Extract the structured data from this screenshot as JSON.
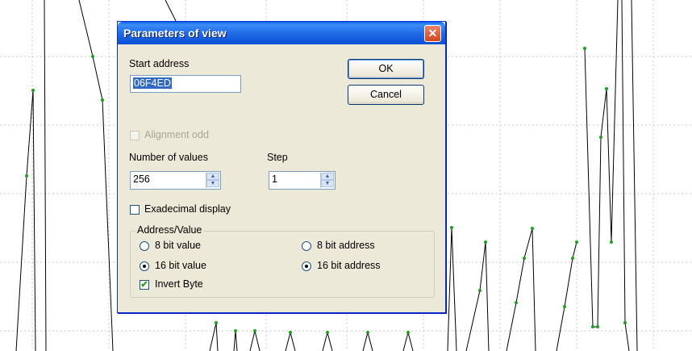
{
  "dialog": {
    "title": "Parameters of view",
    "start_address_label": "Start address",
    "start_address_value": "06F4ED",
    "ok_label": "OK",
    "cancel_label": "Cancel",
    "alignment_label": "Alignment odd",
    "alignment_checked": false,
    "alignment_enabled": false,
    "num_values_label": "Number of values",
    "num_values_value": "256",
    "step_label": "Step",
    "step_value": "1",
    "hex_display_label": "Exadecimal display",
    "hex_display_checked": false,
    "group_title": "Address/Value",
    "radio_8bit_value": "8 bit value",
    "radio_16bit_value": "16 bit value",
    "radio_8bit_address": "8 bit address",
    "radio_16bit_address": "16 bit address",
    "value_width_selected": "16 bit value",
    "address_width_selected": "16 bit address",
    "invert_byte_label": "Invert Byte",
    "invert_byte_checked": true
  },
  "colors": {
    "trace_line": "#000000",
    "trace_points": "#1f9f1f",
    "grid": "#c8c8c8",
    "titlebar": "#0a5fe8",
    "dialog_bg": "#ece9d8"
  }
}
